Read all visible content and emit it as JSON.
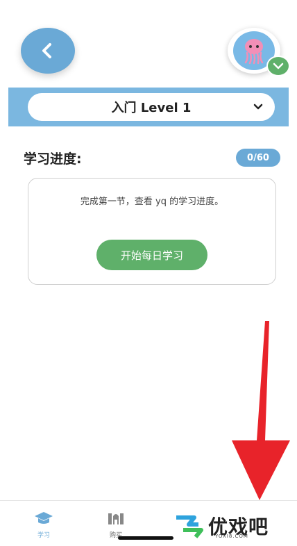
{
  "level_selector": {
    "label": "入门 Level 1"
  },
  "progress": {
    "label": "学习进度:",
    "badge": "0/60",
    "completed": 0,
    "total": 60
  },
  "card": {
    "message": "完成第一节，查看 yq 的学习进度。",
    "start_button": "开始每日学习"
  },
  "tabbar": {
    "tabs": [
      {
        "label": "学习",
        "icon": "graduation-cap-icon",
        "active": true
      },
      {
        "label": "购买",
        "icon": "store-icon",
        "active": false
      }
    ]
  },
  "watermark": {
    "text": "优戏吧",
    "sub": "YOXI8.COM"
  },
  "colors": {
    "primary_blue": "#6aa9d6",
    "band_blue": "#7bb7e0",
    "green": "#5fb06a",
    "arrow_red": "#e8232a"
  }
}
